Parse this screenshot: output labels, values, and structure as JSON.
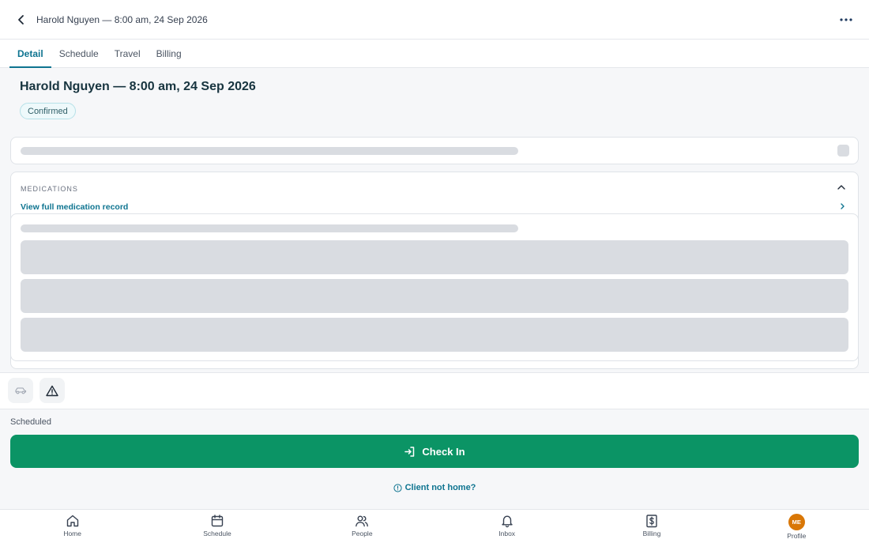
{
  "header": {
    "title": "Harold Nguyen — 8:00 am, 24 Sep 2026"
  },
  "tabs": [
    {
      "label": "Detail",
      "active": true
    },
    {
      "label": "Schedule",
      "active": false
    },
    {
      "label": "Travel",
      "active": false
    },
    {
      "label": "Billing",
      "active": false
    }
  ],
  "visit": {
    "title": "Harold Nguyen — 8:00 am, 24 Sep 2026",
    "status": "Confirmed"
  },
  "medications": {
    "header": "MEDICATIONS",
    "link_label": "View full medication record"
  },
  "actions": {
    "scheduled_label": "Scheduled",
    "checkin_label": "Check In",
    "not_home_label": "Client not home?"
  },
  "bottom_nav": [
    {
      "label": "Home",
      "icon": "home-icon"
    },
    {
      "label": "Schedule",
      "icon": "calendar-icon"
    },
    {
      "label": "People",
      "icon": "people-icon"
    },
    {
      "label": "Inbox",
      "icon": "bell-icon"
    },
    {
      "label": "Billing",
      "icon": "dollar-icon"
    },
    {
      "label": "Profile",
      "icon": "avatar",
      "initials": "ME"
    }
  ],
  "colors": {
    "accent": "#0e7490",
    "primary_button": "#0b9465",
    "avatar": "#d97706",
    "skeleton": "#d9dce1"
  }
}
